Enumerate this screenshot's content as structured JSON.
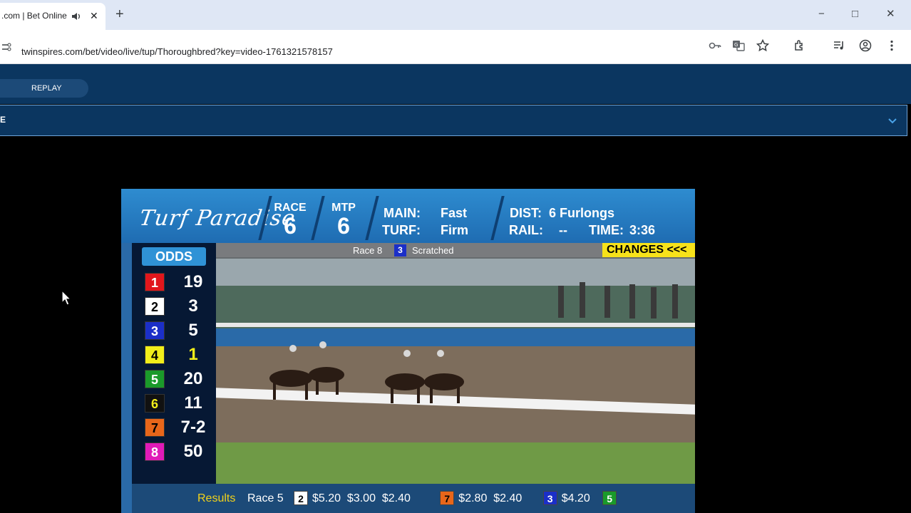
{
  "browser": {
    "tab_title": ".com | Bet Online",
    "url": "twinspires.com/bet/video/live/tup/Thoroughbred?key=video-1761321578157",
    "window_controls": {
      "minimize": "−",
      "maximize": "□",
      "close": "✕"
    },
    "new_tab": "+",
    "tab_close": "✕"
  },
  "site": {
    "replay_label": "REPLAY",
    "subbar_text": "E"
  },
  "broadcast": {
    "track": "Turf Paradise",
    "race_label": "RACE",
    "race_number": "6",
    "mtp_label": "MTP",
    "mtp_value": "6",
    "main_label": "MAIN:",
    "main_value": "Fast",
    "turf_label": "TURF:",
    "turf_value": "Firm",
    "dist_label": "DIST:",
    "dist_value": "6 Furlongs",
    "rail_label": "RAIL:",
    "rail_value": "--",
    "time_label": "TIME:",
    "time_value": "3:36",
    "odds_header": "ODDS",
    "odds": [
      {
        "num": "1",
        "odds": "19",
        "bg": "#e1161c",
        "fg": "#ffffff"
      },
      {
        "num": "2",
        "odds": "3",
        "bg": "#ffffff",
        "fg": "#000000"
      },
      {
        "num": "3",
        "odds": "5",
        "bg": "#1b2fc8",
        "fg": "#ffffff"
      },
      {
        "num": "4",
        "odds": "1",
        "bg": "#f2ee1a",
        "fg": "#000000"
      },
      {
        "num": "5",
        "odds": "20",
        "bg": "#1a9a2a",
        "fg": "#ffffff"
      },
      {
        "num": "6",
        "odds": "11",
        "bg": "#111111",
        "fg": "#f2ee1a"
      },
      {
        "num": "7",
        "odds": "7-2",
        "bg": "#e8661a",
        "fg": "#000000"
      },
      {
        "num": "8",
        "odds": "50",
        "bg": "#e01ab8",
        "fg": "#ffffff"
      }
    ],
    "scratch_race": "Race 8",
    "scratch_num": "3",
    "scratch_text": "Scratched",
    "changes_label": "CHANGES <<<",
    "results_label": "Results",
    "results_race": "Race 5",
    "results": [
      {
        "num": "2",
        "bg": "#ffffff",
        "fg": "#000000",
        "payouts": "$5.20  $3.00  $2.40"
      },
      {
        "num": "7",
        "bg": "#e8661a",
        "fg": "#000000",
        "payouts": "$2.80  $2.40"
      },
      {
        "num": "3",
        "bg": "#1b2fc8",
        "fg": "#ffffff",
        "payouts": "$4.20"
      },
      {
        "num": "5",
        "bg": "#1a9a2a",
        "fg": "#ffffff",
        "payouts": ""
      }
    ]
  }
}
